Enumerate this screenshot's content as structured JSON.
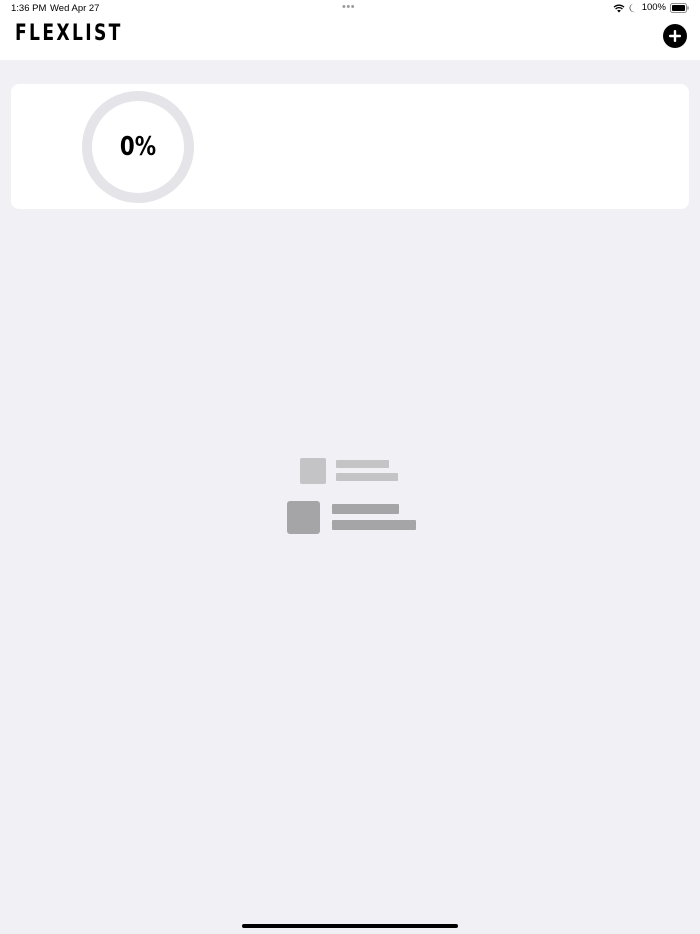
{
  "status_bar": {
    "time": "1:36 PM",
    "date": "Wed Apr 27",
    "multitask_dots": "•••",
    "battery_percent": "100%",
    "icons": [
      "wifi-icon",
      "moon-icon",
      "battery-icon"
    ]
  },
  "header": {
    "app_title": "FLEXLIST",
    "add_icon": "plus-icon"
  },
  "progress": {
    "label": "0%",
    "value": 0
  },
  "empty_state": {
    "icon": "empty-list-icon"
  },
  "colors": {
    "background": "#f0f0f5",
    "card": "#ffffff",
    "ring_track": "#e4e4e9",
    "accent": "#000000"
  }
}
